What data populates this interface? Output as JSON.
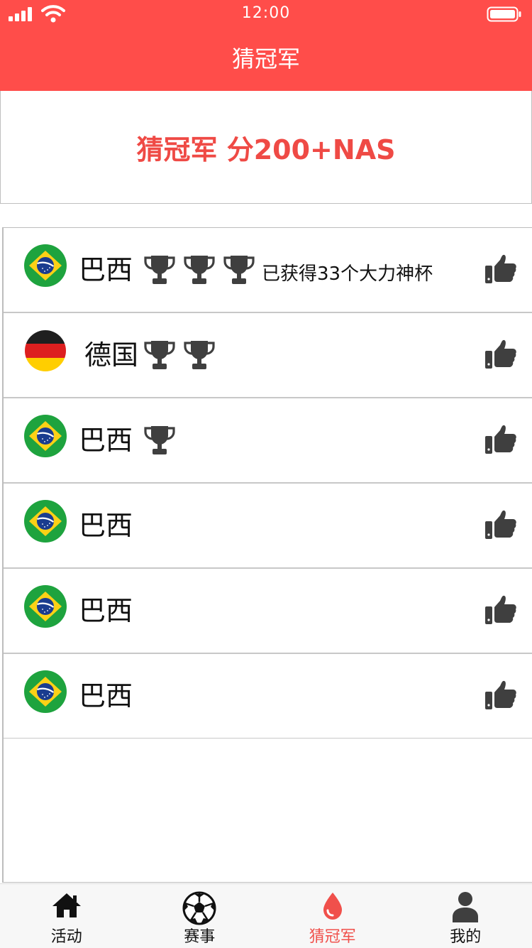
{
  "status_bar": {
    "time": "12:00"
  },
  "header": {
    "title": "猜冠军"
  },
  "banner": {
    "text": "猜冠军 分200+NAS"
  },
  "list": [
    {
      "country": "巴西",
      "flag": "brazil",
      "trophies": 3,
      "award_text": "已获得33个大力神杯"
    },
    {
      "country": "德国",
      "flag": "germany",
      "trophies": 2,
      "award_text": ""
    },
    {
      "country": "巴西",
      "flag": "brazil",
      "trophies": 1,
      "award_text": ""
    },
    {
      "country": "巴西",
      "flag": "brazil",
      "trophies": 0,
      "award_text": ""
    },
    {
      "country": "巴西",
      "flag": "brazil",
      "trophies": 0,
      "award_text": ""
    },
    {
      "country": "巴西",
      "flag": "brazil",
      "trophies": 0,
      "award_text": ""
    }
  ],
  "tabbar": {
    "tabs": [
      {
        "label": "活动",
        "icon": "home-icon",
        "active": false
      },
      {
        "label": "赛事",
        "icon": "soccer-ball-icon",
        "active": false
      },
      {
        "label": "猜冠军",
        "icon": "drop-icon",
        "active": true
      },
      {
        "label": "我的",
        "icon": "user-icon",
        "active": false
      }
    ]
  },
  "colors": {
    "accent": "#ff4d4a",
    "icon_gray": "#3f3f3f",
    "active_tab": "#f0504b"
  }
}
